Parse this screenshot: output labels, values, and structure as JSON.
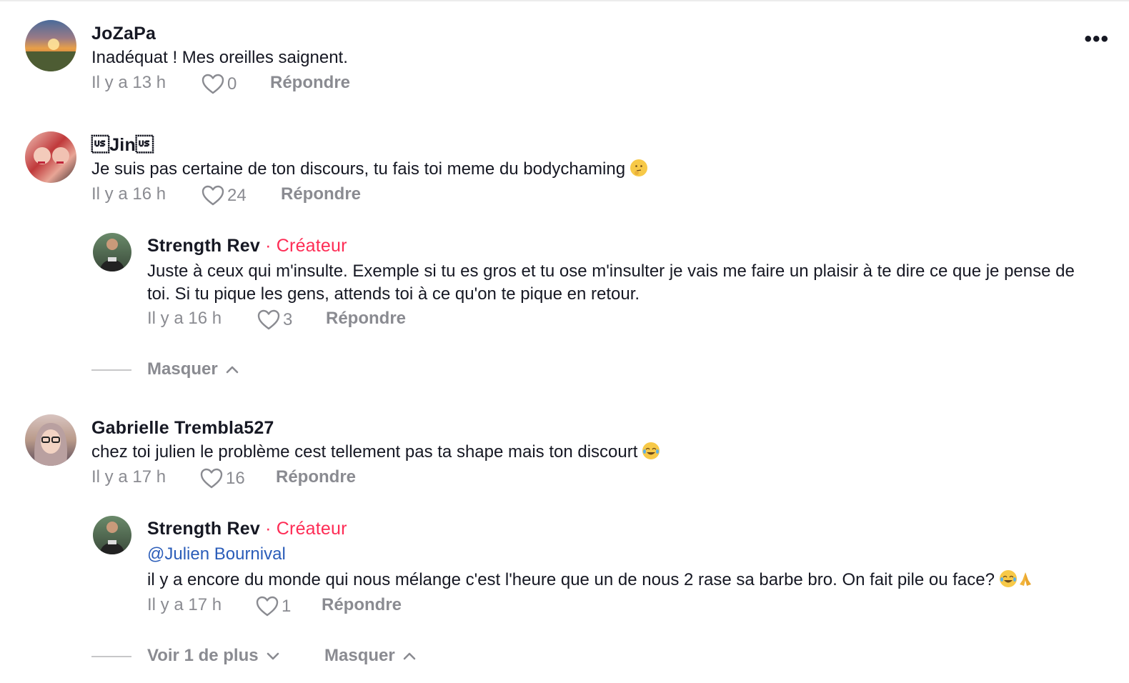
{
  "comments": [
    {
      "username": "JoZaPa",
      "text": "Inadéquat ! Mes oreilles saignent.",
      "time": "Il y a 13 h",
      "likes": "0",
      "reply_label": "Répondre",
      "avatar_colors": [
        "#4a6b9a",
        "#e8a048",
        "#d9633b"
      ]
    },
    {
      "username": "\u001fJin\u001f",
      "text": "Je suis pas certaine de ton discours, tu fais toi meme du bodychaming",
      "emoji": "thinking-face-emoji",
      "time": "Il y a 16 h",
      "likes": "24",
      "reply_label": "Répondre",
      "replies": [
        {
          "username": "Strength Rev",
          "creator_label": " · Créateur",
          "text": "Juste à ceux qui m'insulte. Exemple si tu es gros et tu ose m'insulter je vais me faire un plaisir à te dire ce que je pense de toi. Si tu pique les gens, attends toi à ce qu'on te pique en retour.",
          "time": "Il y a 16 h",
          "likes": "3",
          "reply_label": "Répondre"
        }
      ],
      "hide_label": "Masquer"
    },
    {
      "username": "Gabrielle Trembla527",
      "text": "chez toi julien le problème cest tellement pas ta shape mais ton discourt",
      "emoji": "tears-of-joy-emoji",
      "time": "Il y a 17 h",
      "likes": "16",
      "reply_label": "Répondre",
      "replies": [
        {
          "username": "Strength Rev",
          "creator_label": " · Créateur",
          "mention": "@Julien Bournival",
          "text": "il y a encore du monde qui nous mélange c'est l'heure que un de nous 2 rase sa barbe bro. On fait pile ou face?",
          "time": "Il y a 17 h",
          "likes": "1",
          "reply_label": "Répondre"
        }
      ],
      "more_label": "Voir 1 de plus",
      "hide_label": "Masquer"
    }
  ],
  "colors": {
    "creator": "#fe2c55",
    "mention": "#2b5db9",
    "muted": "#8a8b91",
    "text": "#161823"
  },
  "icons": [
    "more-icon",
    "heart-icon",
    "chevron-up-icon",
    "chevron-down-icon"
  ]
}
